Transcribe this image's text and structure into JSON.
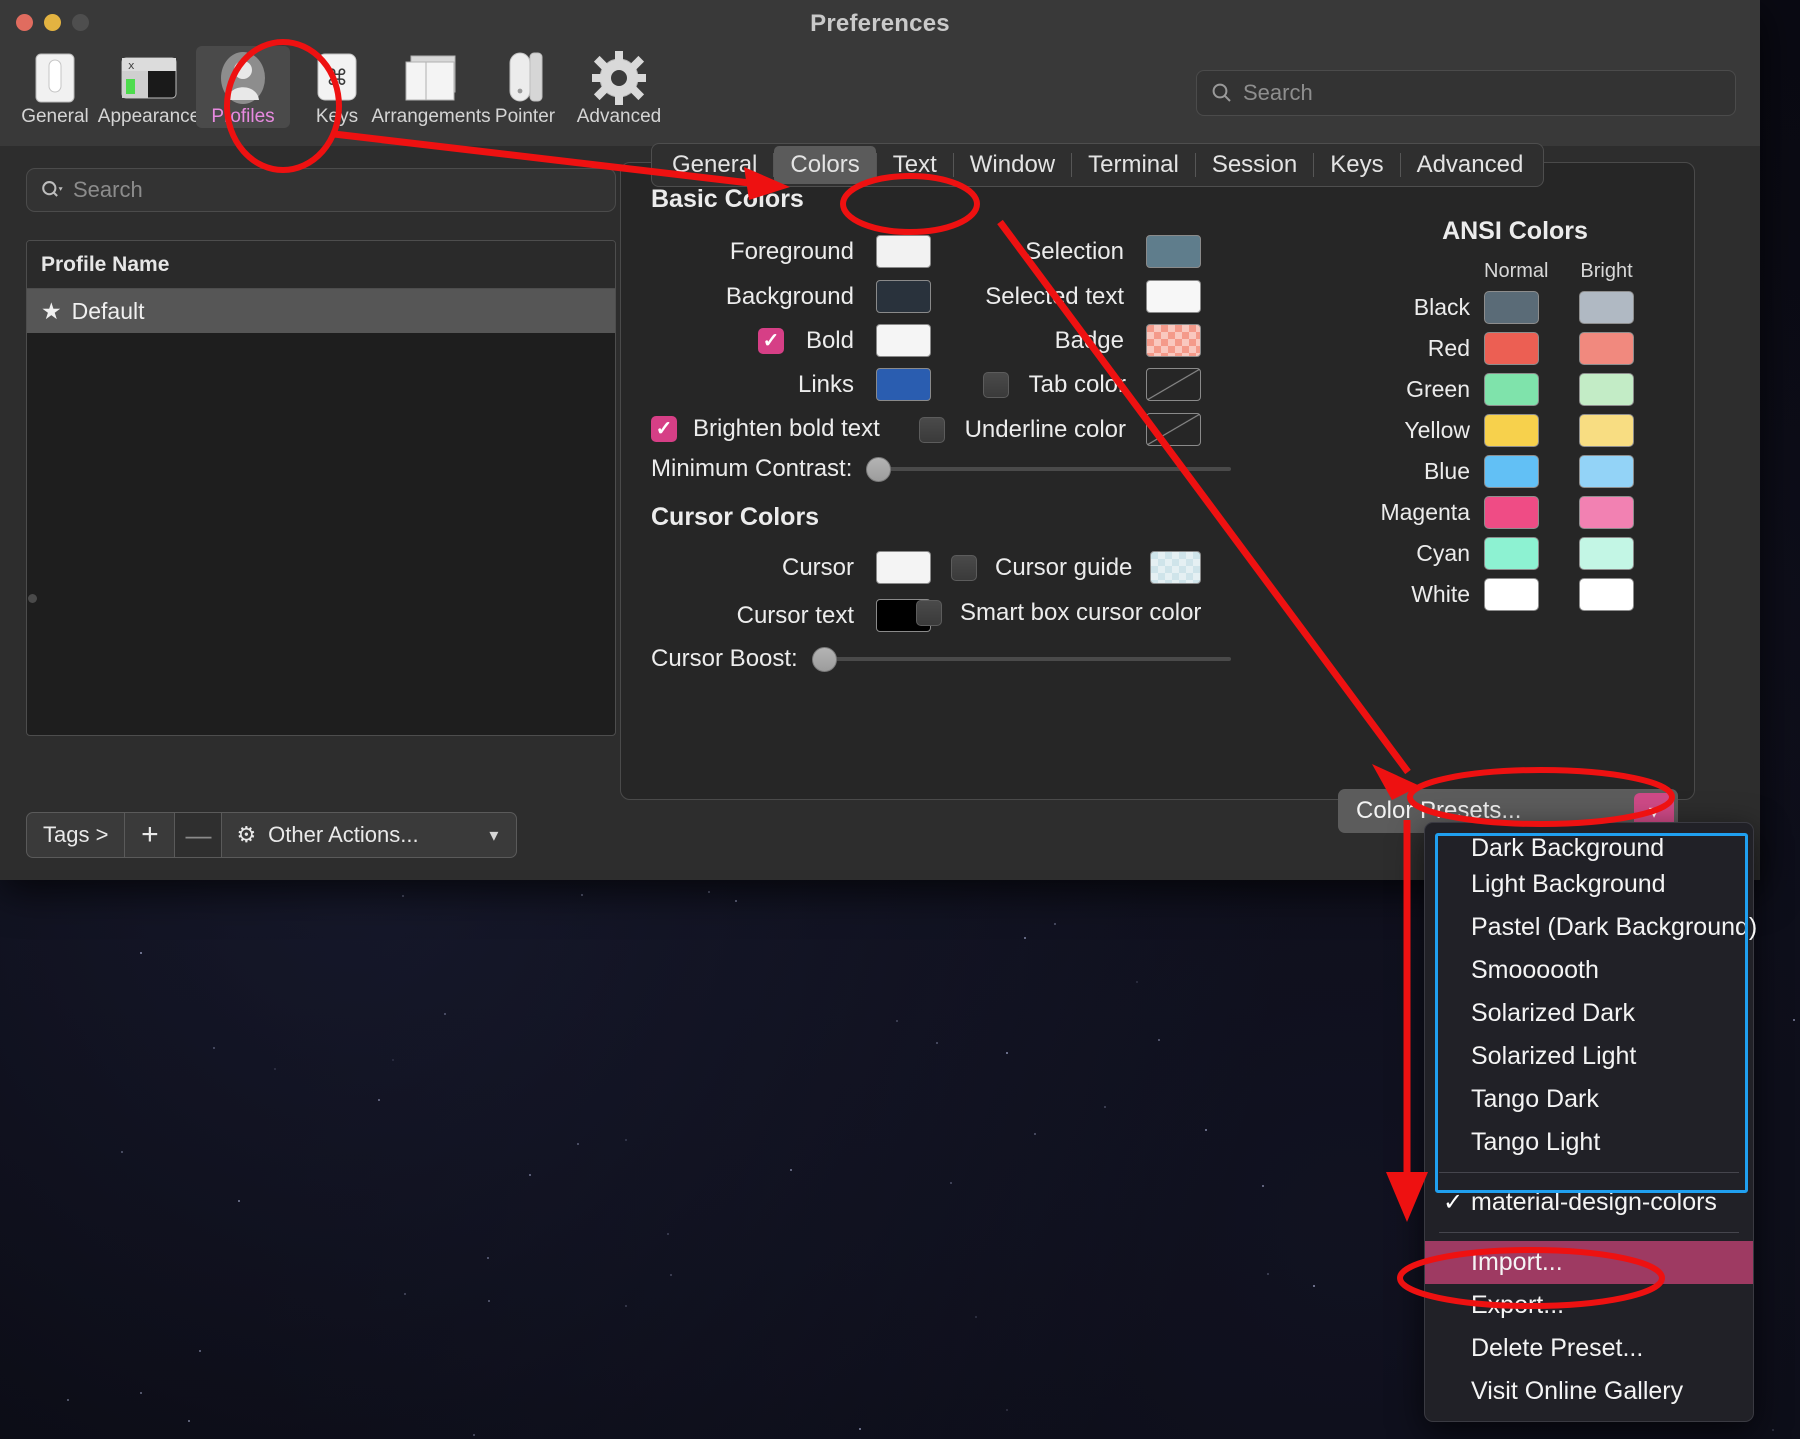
{
  "window": {
    "title": "Preferences",
    "traffic_lights": [
      "close",
      "minimize",
      "zoom"
    ]
  },
  "toolbar": {
    "items": [
      {
        "label": "General",
        "icon": "general-toggle-icon",
        "active": false
      },
      {
        "label": "Appearance",
        "icon": "appearance-window-icon",
        "active": false
      },
      {
        "label": "Profiles",
        "icon": "profiles-person-icon",
        "active": true
      },
      {
        "label": "Keys",
        "icon": "keys-command-icon",
        "active": false
      },
      {
        "label": "Arrangements",
        "icon": "arrangements-panes-icon",
        "active": false
      },
      {
        "label": "Pointer",
        "icon": "pointer-mouse-icon",
        "active": false
      },
      {
        "label": "Advanced",
        "icon": "advanced-gear-icon",
        "active": false
      }
    ],
    "search": {
      "placeholder": "Search",
      "value": "",
      "icon": "search-icon"
    }
  },
  "sidebar": {
    "search": {
      "placeholder": "Search",
      "value": "",
      "icon": "search-dropdown-icon"
    },
    "table": {
      "column_header": "Profile Name",
      "rows": [
        {
          "name": "Default",
          "starred": true,
          "selected": true
        }
      ]
    },
    "bottom_bar": {
      "tags_label": "Tags >",
      "add_label": "+",
      "remove_label": "—",
      "other_actions_label": "Other Actions...",
      "other_actions_icon": "gear-icon",
      "chevron": "chevron-down-icon"
    }
  },
  "tabs": [
    {
      "label": "General",
      "active": false
    },
    {
      "label": "Colors",
      "active": true
    },
    {
      "label": "Text",
      "active": false
    },
    {
      "label": "Window",
      "active": false
    },
    {
      "label": "Terminal",
      "active": false
    },
    {
      "label": "Session",
      "active": false
    },
    {
      "label": "Keys",
      "active": false
    },
    {
      "label": "Advanced",
      "active": false
    }
  ],
  "colors_tab": {
    "basic_colors": {
      "title": "Basic Colors",
      "left": [
        {
          "label": "Foreground",
          "swatch": "#f2f2f2",
          "type": "solid"
        },
        {
          "label": "Background",
          "swatch": "#29323c",
          "type": "solid"
        },
        {
          "label": "Bold",
          "swatch": "#f5f5f5",
          "type": "solid",
          "checkbox": true,
          "checked": true
        },
        {
          "label": "Links",
          "swatch": "#2a5db0",
          "type": "solid"
        }
      ],
      "right": [
        {
          "label": "Selection",
          "swatch": "#5f7d8c",
          "type": "solid"
        },
        {
          "label": "Selected text",
          "swatch": "#f7f7f7",
          "type": "solid"
        },
        {
          "label": "Badge",
          "swatch": "#f49a8a",
          "type": "checker"
        },
        {
          "label": "Tab color",
          "swatch": "",
          "type": "diagonal",
          "checkbox": true,
          "checked": false
        },
        {
          "label": "Underline color",
          "swatch": "",
          "type": "diagonal",
          "checkbox": true,
          "checked": false
        }
      ],
      "brighten_bold_text": {
        "label": "Brighten bold text",
        "checked": true
      },
      "minimum_contrast": {
        "label": "Minimum Contrast:",
        "value": 0
      }
    },
    "cursor_colors": {
      "title": "Cursor Colors",
      "cursor": {
        "label": "Cursor",
        "swatch": "#f4f4f4"
      },
      "cursor_text": {
        "label": "Cursor text",
        "swatch": "#000000"
      },
      "cursor_guide": {
        "label": "Cursor guide",
        "swatch": "#cfe4ea",
        "type": "checker",
        "checked": false
      },
      "smart_box_cursor_color": {
        "label": "Smart box cursor color",
        "checked": false
      },
      "cursor_boost": {
        "label": "Cursor Boost:",
        "value": 0
      }
    },
    "ansi_colors": {
      "title": "ANSI Colors",
      "col_normal": "Normal",
      "col_bright": "Bright",
      "rows": [
        {
          "name": "Black",
          "normal": "#5a6b77",
          "bright": "#b0b9c3"
        },
        {
          "name": "Red",
          "normal": "#ec5f53",
          "bright": "#f1897e"
        },
        {
          "name": "Green",
          "normal": "#7fe3ab",
          "bright": "#c3ecc6"
        },
        {
          "name": "Yellow",
          "normal": "#f7d14c",
          "bright": "#f8dd82"
        },
        {
          "name": "Blue",
          "normal": "#62c0f5",
          "bright": "#93d3f7"
        },
        {
          "name": "Magenta",
          "normal": "#ef4c85",
          "bright": "#f281b2"
        },
        {
          "name": "Cyan",
          "normal": "#8df2d2",
          "bright": "#c3f6e5"
        },
        {
          "name": "White",
          "normal": "#ffffff",
          "bright": "#ffffff"
        }
      ]
    },
    "color_presets_button": {
      "label": "Color Presets...",
      "arrow": "chevron-down-icon"
    }
  },
  "presets_menu": {
    "items": [
      {
        "label": "Dark Background",
        "checked": false,
        "highlight": false,
        "clipped": true
      },
      {
        "label": "Light Background",
        "checked": false,
        "highlight": false
      },
      {
        "label": "Pastel (Dark Background)",
        "checked": false,
        "highlight": false
      },
      {
        "label": "Smoooooth",
        "checked": false,
        "highlight": false
      },
      {
        "label": "Solarized Dark",
        "checked": false,
        "highlight": false
      },
      {
        "label": "Solarized Light",
        "checked": false,
        "highlight": false
      },
      {
        "label": "Tango Dark",
        "checked": false,
        "highlight": false
      },
      {
        "label": "Tango Light",
        "checked": false,
        "highlight": false
      }
    ],
    "checked_item": {
      "label": "material-design-colors",
      "checked": true
    },
    "actions": [
      {
        "label": "Import...",
        "highlight": true
      },
      {
        "label": "Export...",
        "highlight": false
      },
      {
        "label": "Delete Preset...",
        "highlight": false
      },
      {
        "label": "Visit Online Gallery",
        "highlight": false
      }
    ]
  },
  "annotations": {
    "highlight_color": "#ee1111",
    "focus_ring_color": "#20a0f0",
    "marks": [
      {
        "shape": "ellipse",
        "target": "profiles-toolbar-item"
      },
      {
        "shape": "ellipse",
        "target": "colors-tab"
      },
      {
        "shape": "ellipse",
        "target": "color-presets-button"
      },
      {
        "shape": "ellipse",
        "target": "import-menu-item"
      },
      {
        "shape": "arrow",
        "from": "profiles-toolbar-item",
        "to": "colors-tab"
      },
      {
        "shape": "arrow",
        "from": "colors-tab",
        "to": "color-presets-button"
      },
      {
        "shape": "arrow",
        "from": "color-presets-button",
        "to": "import-menu-item"
      }
    ]
  }
}
